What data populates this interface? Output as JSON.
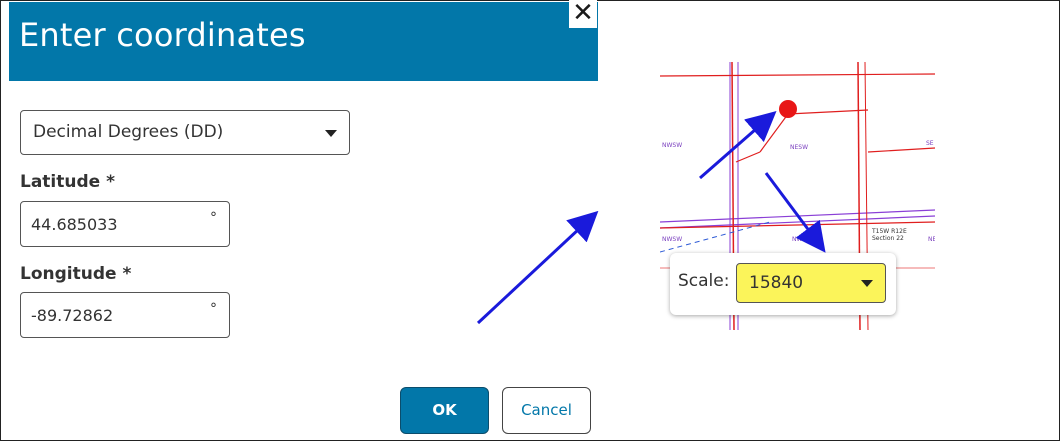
{
  "dialog": {
    "title": "Enter coordinates",
    "close_glyph": "✕",
    "format_select": {
      "selected": "Decimal Degrees (DD)"
    },
    "latitude": {
      "label": "Latitude *",
      "value": "44.685033",
      "unit": "°"
    },
    "longitude": {
      "label": "Longitude *",
      "value": "-89.72862",
      "unit": "°"
    },
    "ok_label": "OK",
    "cancel_label": "Cancel"
  },
  "map": {
    "labels": [
      "NESW",
      "SE",
      "NWSW",
      "NE",
      "T15W R12E",
      "Section 22",
      "NW",
      "NWSW"
    ],
    "scale": {
      "label": "Scale:",
      "value": "15840"
    }
  },
  "colors": {
    "header_blue": "#0277a9",
    "highlight_yellow": "#fbf45a",
    "parcel_line_red": "#e01e1e",
    "section_line_purple": "#8a3fd6",
    "marker_red": "#e81616",
    "annotation_arrow_blue": "#1a1adb"
  },
  "icons": {
    "close": "close-icon",
    "dropdown": "chevron-down-icon",
    "location": "location-marker-icon",
    "annotation": "arrow-annotation-icon"
  }
}
